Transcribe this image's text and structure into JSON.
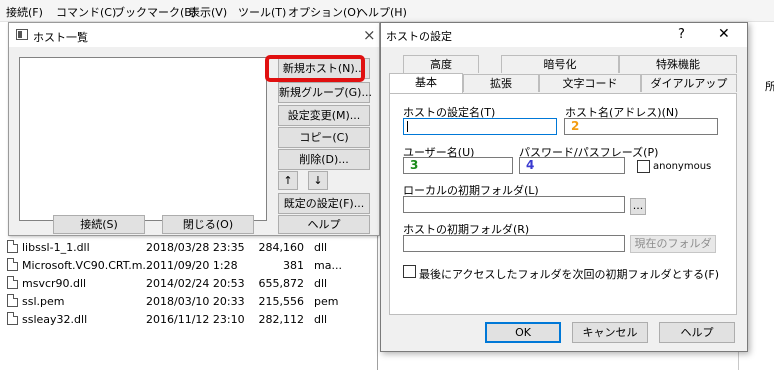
{
  "menubar": {
    "items": [
      "接続(F)",
      "コマンド(C)",
      "ブックマーク(B)",
      "表示(V)",
      "ツール(T)",
      "オプション(O)",
      "ヘルプ(H)"
    ]
  },
  "file_list": {
    "rows": [
      {
        "name": "libssl-1_1.dll",
        "date": "2018/03/28 23:35",
        "size": "284,160",
        "type": "dll"
      },
      {
        "name": "Microsoft.VC90.CRT.m...",
        "date": "2011/09/20  1:28",
        "size": "381",
        "type": "ma..."
      },
      {
        "name": "msvcr90.dll",
        "date": "2014/02/24 20:53",
        "size": "655,872",
        "type": "dll"
      },
      {
        "name": "ssl.pem",
        "date": "2018/03/10 20:33",
        "size": "215,556",
        "type": "pem"
      },
      {
        "name": "ssleay32.dll",
        "date": "2016/11/12 23:10",
        "size": "282,112",
        "type": "dll"
      }
    ],
    "right_header_fragment": "所"
  },
  "host_list": {
    "title": "ホスト一覧",
    "close_glyph": "×",
    "buttons": {
      "new_host": "新規ホスト(N)...",
      "new_group": "新規グループ(G)...",
      "change_settings": "設定変更(M)...",
      "copy": "コピー(C)",
      "delete": "削除(D)...",
      "up": "↑",
      "down": "↓",
      "default_settings": "既定の設定(F)...",
      "connect": "接続(S)",
      "close": "閉じる(O)",
      "help": "ヘルプ"
    }
  },
  "host_settings": {
    "title": "ホストの設定",
    "help_glyph": "?",
    "close_glyph": "✕",
    "tabs_row1": [
      "高度",
      "暗号化",
      "特殊機能"
    ],
    "tabs_row2": [
      "基本",
      "拡張",
      "文字コード",
      "ダイアルアップ"
    ],
    "labels": {
      "host_setting_name": "ホストの設定名(T)",
      "host_name": "ホスト名(アドレス)(N)",
      "username": "ユーザー名(U)",
      "password": "パスワード/パスフレーズ(P)",
      "anonymous": "anonymous",
      "local_folder": "ローカルの初期フォルダ(L)",
      "host_folder": "ホストの初期フォルダ(R)",
      "last_folder_checkbox": "最後にアクセスしたフォルダを次回の初期フォルダとする(F)"
    },
    "values": {
      "host_setting_name": "",
      "host_name": "2",
      "username": "3",
      "password": "4",
      "local_folder": "",
      "host_folder": ""
    },
    "value_colors": {
      "host_name": "#f39c12",
      "username": "#1a8a1a",
      "password": "#3a3ad0"
    },
    "buttons": {
      "browse": "...",
      "current_folder": "現在のフォルダ",
      "ok": "OK",
      "cancel": "キャンセル",
      "help": "ヘルプ"
    }
  }
}
